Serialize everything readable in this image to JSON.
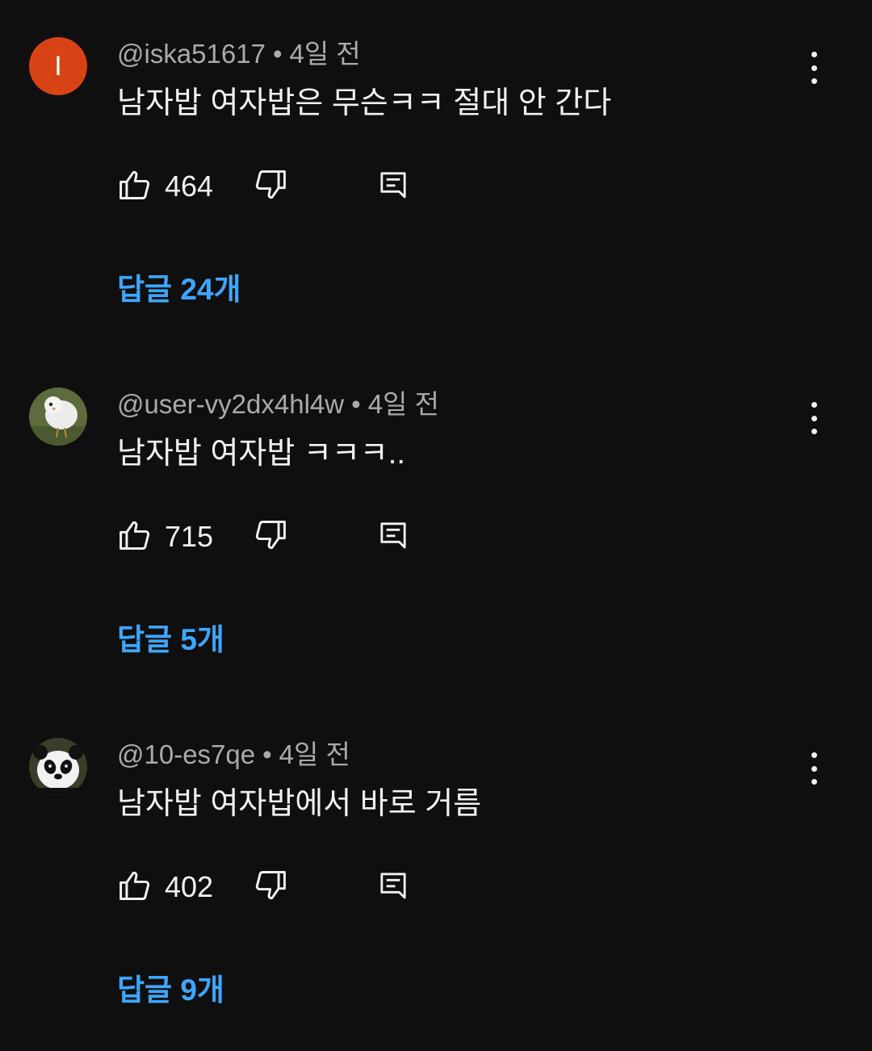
{
  "comments": [
    {
      "author": "@iska51617",
      "time": "4일 전",
      "text": "남자밥 여자밥은 무슨ㅋㅋ 절대 안 간다",
      "likes": "464",
      "replies_label": "답글 24개",
      "avatar": {
        "type": "letter",
        "letter": "I",
        "color": "#d84315"
      }
    },
    {
      "author": "@user-vy2dx4hl4w",
      "time": "4일 전",
      "text": "남자밥 여자밥 ㅋㅋㅋ..",
      "likes": "715",
      "replies_label": "답글 5개",
      "avatar": {
        "type": "image",
        "icon": "white-bird-avatar"
      }
    },
    {
      "author": "@10-es7qe",
      "time": "4일 전",
      "text": "남자밥 여자밥에서 바로 거름",
      "likes": "402",
      "replies_label": "답글 9개",
      "avatar": {
        "type": "image",
        "icon": "panda-avatar"
      }
    }
  ],
  "separator": "•",
  "icons": {
    "like": "thumbs-up-icon",
    "dislike": "thumbs-down-icon",
    "reply": "reply-icon",
    "menu": "more-vert-icon"
  },
  "colors": {
    "background": "#0f0f0f",
    "text": "#f1f1f1",
    "meta": "#aaaaaa",
    "link": "#3ea6ff"
  }
}
